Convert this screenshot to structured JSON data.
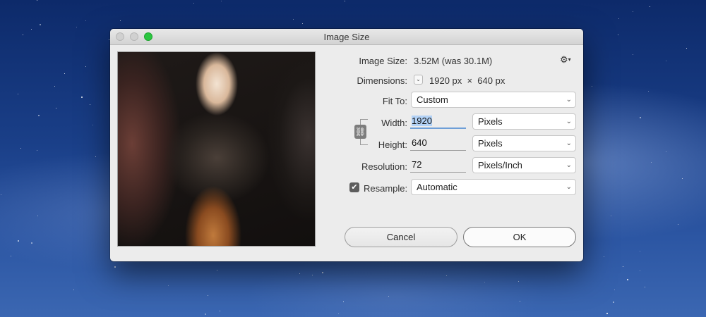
{
  "window": {
    "title": "Image Size"
  },
  "info": {
    "image_size_label": "Image Size:",
    "image_size_value": "3.52M (was 30.1M)",
    "dimensions_label": "Dimensions:",
    "dimensions_value": "1920 px  ×  640 px"
  },
  "fit_to": {
    "label": "Fit To:",
    "value": "Custom"
  },
  "width": {
    "label": "Width:",
    "value": "1920",
    "unit": "Pixels"
  },
  "height": {
    "label": "Height:",
    "value": "640",
    "unit": "Pixels"
  },
  "resolution": {
    "label": "Resolution:",
    "value": "72",
    "unit": "Pixels/Inch"
  },
  "resample": {
    "label": "Resample:",
    "checked": true,
    "value": "Automatic"
  },
  "buttons": {
    "cancel": "Cancel",
    "ok": "OK"
  },
  "icons": {
    "gear": "gear-icon",
    "chain": "link-chain-icon",
    "chevron": "chevron-down-icon",
    "check": "checkmark-icon"
  },
  "colors": {
    "traffic_max": "#2bc640",
    "selection": "#b3d2f6",
    "dialog_bg": "#ececec"
  }
}
